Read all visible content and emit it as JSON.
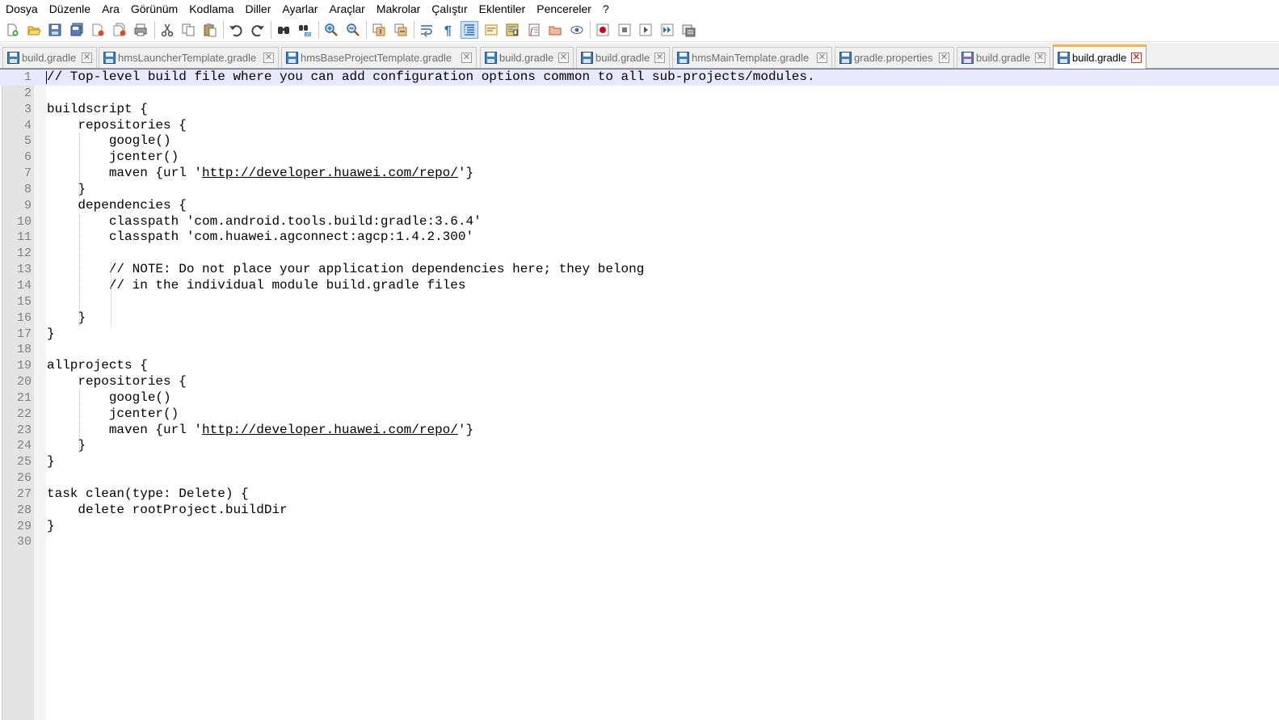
{
  "menu": [
    "Dosya",
    "Düzenle",
    "Ara",
    "Görünüm",
    "Kodlama",
    "Diller",
    "Ayarlar",
    "Araçlar",
    "Makrolar",
    "Çalıştır",
    "Eklentiler",
    "Pencereler",
    "?"
  ],
  "toolbar": {
    "buttons": [
      {
        "icon": "new-file-icon"
      },
      {
        "icon": "open-file-icon"
      },
      {
        "icon": "save-icon"
      },
      {
        "icon": "save-all-icon"
      },
      {
        "icon": "close-file-icon"
      },
      {
        "icon": "close-all-icon"
      },
      {
        "icon": "print-icon"
      },
      {
        "sep": true
      },
      {
        "icon": "cut-icon"
      },
      {
        "icon": "copy-icon"
      },
      {
        "icon": "paste-icon"
      },
      {
        "sep": true
      },
      {
        "icon": "undo-icon"
      },
      {
        "icon": "redo-icon"
      },
      {
        "sep": true
      },
      {
        "icon": "find-icon"
      },
      {
        "icon": "replace-icon"
      },
      {
        "sep": true
      },
      {
        "icon": "zoom-in-icon"
      },
      {
        "icon": "zoom-out-icon"
      },
      {
        "sep": true
      },
      {
        "icon": "sync-vertical-icon"
      },
      {
        "icon": "sync-horizontal-icon"
      },
      {
        "sep": true
      },
      {
        "icon": "word-wrap-icon"
      },
      {
        "icon": "show-all-chars-icon"
      },
      {
        "icon": "indent-guide-icon",
        "active": true
      },
      {
        "icon": "language-icon"
      },
      {
        "icon": "doc-map-icon"
      },
      {
        "icon": "function-list-icon"
      },
      {
        "icon": "folder-workspace-icon"
      },
      {
        "icon": "monitoring-icon"
      },
      {
        "sep": true
      },
      {
        "icon": "record-macro-icon"
      },
      {
        "icon": "stop-record-icon"
      },
      {
        "icon": "play-macro-icon"
      },
      {
        "icon": "run-macro-multiple-icon"
      },
      {
        "icon": "save-macro-icon"
      }
    ]
  },
  "tabs": [
    {
      "label": "build.gradle",
      "active": false
    },
    {
      "label": "hmsLauncherTemplate.gradle",
      "active": false
    },
    {
      "label": "hmsBaseProjectTemplate.gradle",
      "active": false
    },
    {
      "label": "build.gradle",
      "active": false
    },
    {
      "label": "build.gradle",
      "active": false
    },
    {
      "label": "hmsMainTemplate.gradle",
      "active": false
    },
    {
      "label": "gradle.properties",
      "active": false
    },
    {
      "label": "build.gradle",
      "active": false
    },
    {
      "label": "build.gradle",
      "active": true
    }
  ],
  "editor": {
    "current_line": 1,
    "lines": [
      "// Top-level build file where you can add configuration options common to all sub-projects/modules.",
      "",
      "buildscript {",
      "    repositories {",
      "        google()",
      "        jcenter()",
      "        maven {url 'http://developer.huawei.com/repo/'}",
      "    }",
      "    dependencies {",
      "        classpath 'com.android.tools.build:gradle:3.6.4'",
      "        classpath 'com.huawei.agconnect:agcp:1.4.2.300'",
      "",
      "        // NOTE: Do not place your application dependencies here; they belong",
      "        // in the individual module build.gradle files",
      "",
      "    }",
      "}",
      "",
      "allprojects {",
      "    repositories {",
      "        google()",
      "        jcenter()",
      "        maven {url 'http://developer.huawei.com/repo/'}",
      "    }",
      "}",
      "",
      "task clean(type: Delete) {",
      "    delete rootProject.buildDir",
      "}",
      ""
    ],
    "url_text": "http://developer.huawei.com/repo/"
  },
  "colors": {
    "active_tab_accent": "#fab24a",
    "current_line_bg": "#e8e8ff",
    "gutter_bg": "#e4e4e4",
    "line_number": "#808080"
  }
}
